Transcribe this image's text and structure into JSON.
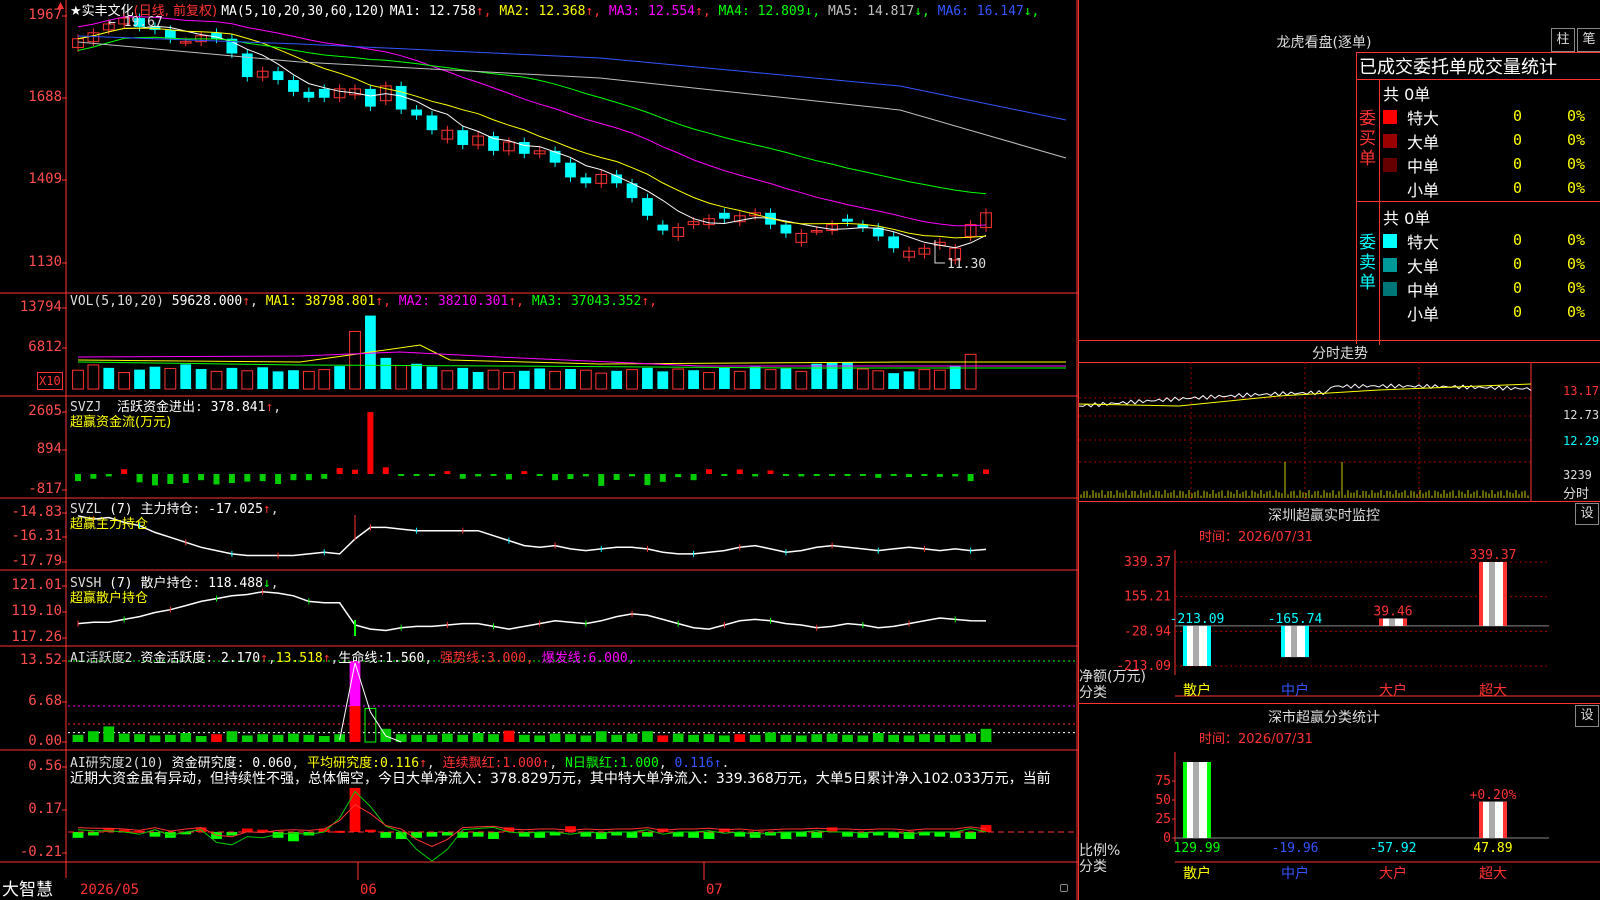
{
  "chart_data": [
    {
      "type": "candlestick",
      "title": "实丰文化",
      "name": "实丰文化",
      "period": "(日线, 前复权)",
      "ma_label": "MA(5,10,20,30,60,120)",
      "ma_values": [
        {
          "name": "MA1",
          "value": "12.758",
          "arrow": "↑",
          "color": "#ffffff"
        },
        {
          "name": "MA2",
          "value": "12.368",
          "arrow": "↑",
          "color": "#ffff00"
        },
        {
          "name": "MA3",
          "value": "12.554",
          "arrow": "↑",
          "color": "#ff00ff"
        },
        {
          "name": "MA4",
          "value": "12.809",
          "arrow": "↓",
          "color": "#00ff00"
        },
        {
          "name": "MA5",
          "value": "14.817",
          "arrow": "↓",
          "color": "#c0c0c0"
        },
        {
          "name": "MA6",
          "value": "16.147",
          "arrow": "↓",
          "color": "#3355ff"
        }
      ],
      "y_ticks": [
        "1967",
        "1688",
        "1409",
        "1130"
      ],
      "high_label": "19.67",
      "low_label": "11.30",
      "x_ticks": [
        "2026/05",
        "06",
        "07"
      ]
    },
    {
      "type": "bar",
      "title": "VOL(5,10,20)",
      "value": "59628.000",
      "ma_values": [
        {
          "name": "MA1",
          "value": "38798.801",
          "arrow": "↑",
          "color": "#ffff00"
        },
        {
          "name": "MA2",
          "value": "38210.301",
          "arrow": "↑",
          "color": "#ff00ff"
        },
        {
          "name": "MA3",
          "value": "37043.352",
          "arrow": "↑",
          "color": "#00ff00"
        }
      ],
      "y_ticks": [
        "13794",
        "6812"
      ],
      "unit": "X10",
      "values": [
        3.2,
        4.1,
        3.6,
        2.8,
        3.3,
        3.8,
        3.5,
        4.2,
        3.4,
        3.0,
        3.6,
        3.1,
        3.7,
        3.0,
        3.2,
        3.0,
        3.3,
        3.9,
        9.8,
        12.5,
        5.3,
        4.0,
        4.3,
        3.8,
        3.1,
        3.6,
        2.9,
        3.2,
        2.8,
        3.1,
        3.5,
        3.0,
        3.4,
        3.2,
        2.7,
        3.1,
        3.3,
        3.6,
        3.0,
        3.4,
        3.2,
        2.8,
        3.6,
        3.0,
        3.8,
        3.3,
        3.5,
        3.0,
        4.3,
        4.6,
        4.6,
        3.4,
        3.1,
        2.7,
        3.0,
        3.3,
        3.2,
        3.9,
        5.9
      ],
      "up": [
        1,
        1,
        0,
        1,
        0,
        0,
        1,
        0,
        0,
        1,
        0,
        1,
        0,
        0,
        0,
        1,
        1,
        0,
        1,
        0,
        0,
        1,
        0,
        0,
        1,
        0,
        0,
        1,
        1,
        0,
        0,
        1,
        0,
        1,
        1,
        0,
        1,
        0,
        0,
        1,
        0,
        1,
        0,
        1,
        0,
        1,
        0,
        1,
        0,
        0,
        0,
        1,
        1,
        0,
        0,
        1,
        1,
        0,
        1
      ]
    },
    {
      "type": "bar",
      "title": "SVZJ",
      "label": "活跃资金进出",
      "value": "378.841",
      "subtitle": "超赢资金流(万元)",
      "y_ticks": [
        "2605",
        "894",
        "-817"
      ],
      "values": [
        -300,
        -200,
        -100,
        200,
        -350,
        -480,
        -420,
        -380,
        -260,
        -440,
        -380,
        -320,
        -300,
        -420,
        -260,
        -260,
        -200,
        250,
        180,
        2600,
        280,
        -30,
        -40,
        -60,
        120,
        -200,
        -100,
        -60,
        -230,
        120,
        -40,
        -260,
        -210,
        -100,
        -500,
        -250,
        -100,
        -470,
        -330,
        -130,
        -260,
        200,
        -40,
        190,
        -100,
        150,
        -40,
        -100,
        -80,
        -40,
        -40,
        -60,
        -160,
        -40,
        -130,
        -40,
        -120,
        -100,
        -300,
        190
      ]
    },
    {
      "type": "line",
      "title": "SVZL",
      "label": "(7) 主力持仓",
      "value": "-17.025",
      "subtitle": "超赢主力持仓",
      "y_ticks": [
        "-14.83",
        "-16.31",
        "-17.79"
      ],
      "values": [
        -15.0,
        -15.2,
        -15.1,
        -15.4,
        -15.6,
        -16.0,
        -16.3,
        -16.6,
        -16.9,
        -17.1,
        -17.3,
        -17.4,
        -17.4,
        -17.4,
        -17.4,
        -17.3,
        -17.2,
        -17.3,
        -16.4,
        -15.7,
        -15.7,
        -15.8,
        -15.9,
        -15.9,
        -15.9,
        -15.9,
        -15.9,
        -16.2,
        -16.5,
        -16.8,
        -16.9,
        -16.8,
        -17.0,
        -17.1,
        -17.0,
        -16.9,
        -16.9,
        -17.0,
        -17.2,
        -17.3,
        -17.3,
        -17.2,
        -17.1,
        -16.9,
        -16.8,
        -17.0,
        -17.2,
        -17.1,
        -16.9,
        -16.8,
        -16.9,
        -17.0,
        -17.1,
        -17.0,
        -16.9,
        -17.0,
        -17.1,
        -17.0,
        -17.1,
        -17.03
      ]
    },
    {
      "type": "line",
      "title": "SVSH",
      "label": "(7) 散户持仓",
      "value": "118.488",
      "subtitle": "超赢散户持仓",
      "y_ticks": [
        "121.01",
        "119.10",
        "117.26"
      ],
      "values": [
        118.3,
        118.4,
        118.4,
        118.6,
        118.8,
        119.1,
        119.3,
        119.6,
        119.9,
        120.1,
        120.3,
        120.4,
        120.6,
        120.5,
        120.3,
        119.9,
        119.8,
        119.8,
        118.2,
        117.9,
        117.8,
        118.0,
        118.1,
        118.1,
        118.2,
        118.3,
        118.3,
        118.1,
        117.9,
        118.1,
        118.3,
        118.5,
        118.4,
        118.3,
        118.5,
        118.8,
        119.0,
        118.9,
        118.6,
        118.3,
        118.0,
        117.9,
        118.2,
        118.5,
        118.6,
        118.5,
        118.3,
        118.2,
        118.0,
        118.1,
        118.3,
        118.2,
        118.0,
        118.1,
        118.3,
        118.5,
        118.7,
        118.6,
        118.5,
        118.49
      ]
    },
    {
      "type": "bar",
      "title": "AI活跃度2",
      "label": "资金活跃度",
      "value": "2.170",
      "value2": "13.518",
      "life_label": "生命线",
      "life_value": "1.560",
      "strong_label": "强势线",
      "strong_value": "3.000",
      "burst_label": "爆发线",
      "burst_value": "6.000",
      "y_ticks": [
        "13.52",
        "6.68",
        "0.00"
      ],
      "values": [
        1.2,
        1.8,
        2.6,
        1.4,
        1.3,
        1.1,
        1.2,
        1.5,
        1.0,
        1.3,
        1.8,
        1.1,
        1.3,
        1.2,
        1.4,
        1.2,
        1.0,
        1.3,
        13.5,
        5.6,
        2.2,
        1.3,
        1.2,
        1.2,
        1.4,
        1.2,
        1.5,
        1.3,
        1.9,
        1.2,
        1.1,
        1.4,
        1.3,
        1.1,
        1.8,
        1.2,
        1.4,
        1.8,
        1.1,
        1.4,
        1.2,
        1.3,
        1.1,
        1.3,
        1.2,
        1.6,
        1.2,
        1.1,
        1.3,
        1.4,
        1.2,
        1.1,
        1.5,
        1.2,
        1.1,
        1.3,
        1.2,
        1.2,
        1.4,
        2.2
      ]
    },
    {
      "type": "bar",
      "title": "AI研究度2(10)",
      "label": "资金研究度",
      "value": "0.060",
      "avg_label": "平均研究度",
      "avg_value": "0.116",
      "lianxu_label": "连续飘红",
      "lianxu_value": "1.000",
      "nday_label": "N日飘红",
      "nday_value": "1.000",
      "last_value": "0.116",
      "y_ticks": [
        "0.56",
        "0.17",
        "-0.21"
      ],
      "values": [
        -0.05,
        -0.03,
        0.03,
        0.02,
        0.01,
        -0.04,
        -0.05,
        -0.02,
        0.04,
        -0.06,
        -0.03,
        0.03,
        0.02,
        -0.05,
        -0.08,
        -0.03,
        0.03,
        0.01,
        0.38,
        0.02,
        -0.05,
        -0.06,
        -0.05,
        -0.04,
        -0.03,
        -0.05,
        -0.04,
        -0.06,
        0.04,
        -0.04,
        -0.05,
        -0.03,
        0.05,
        -0.04,
        -0.06,
        -0.03,
        -0.05,
        -0.04,
        0.03,
        -0.04,
        -0.05,
        -0.06,
        0.03,
        -0.04,
        -0.05,
        -0.03,
        -0.06,
        -0.04,
        -0.05,
        0.04,
        -0.04,
        -0.05,
        -0.03,
        -0.05,
        -0.06,
        -0.03,
        -0.04,
        -0.05,
        -0.06,
        0.06
      ],
      "line": [
        0.02,
        0.01,
        0.01,
        0.0,
        -0.02,
        0.02,
        -0.03,
        0.0,
        0.02,
        -0.09,
        -0.11,
        -0.04,
        -0.05,
        -0.02,
        -0.01,
        -0.02,
        0.0,
        0.12,
        0.35,
        0.22,
        0.05,
        0.0,
        -0.15,
        -0.25,
        -0.15,
        0.02,
        0.03,
        0.04,
        0.0,
        -0.01,
        0.0,
        0.0,
        -0.02,
        0.0,
        -0.01,
        0.0,
        0.0,
        0.02,
        -0.02,
        0.0,
        0.0,
        0.01,
        -0.01,
        0.0,
        -0.02,
        -0.01,
        0.0,
        0.0,
        0.01,
        0.0,
        0.0,
        -0.01,
        0.0,
        0.0,
        -0.02,
        0.0,
        0.0,
        0.0,
        0.03,
        0.0
      ]
    }
  ],
  "ai_text": "近期大资金虽有异动，但持续性不强，总体偏空，今日大单净流入：378.829万元，其中特大单净流入：339.368万元，大单5日累计净入102.033万元，当前",
  "brand": "大智慧",
  "right": {
    "longhu_title": "龙虎看盘(逐单)",
    "tab_zhu": "柱",
    "tab_bi": "笔",
    "order_header": "已成交委托单成交量统计",
    "buy_label": "委买单",
    "sell_label": "委卖单",
    "buy_total": "共 0单",
    "sell_total": "共 0单",
    "buy_rows": [
      {
        "label": "特大",
        "count": "0",
        "pct": "0%",
        "color": "#ff0000"
      },
      {
        "label": "大单",
        "count": "0",
        "pct": "0%",
        "color": "#990000"
      },
      {
        "label": "中单",
        "count": "0",
        "pct": "0%",
        "color": "#660000"
      },
      {
        "label": "小单",
        "count": "0",
        "pct": "0%",
        "color": ""
      }
    ],
    "sell_rows": [
      {
        "label": "特大",
        "count": "0",
        "pct": "0%",
        "color": "#00ffff"
      },
      {
        "label": "大单",
        "count": "0",
        "pct": "0%",
        "color": "#009999"
      },
      {
        "label": "中单",
        "count": "0",
        "pct": "0%",
        "color": "#007777"
      },
      {
        "label": "小单",
        "count": "0",
        "pct": "0%",
        "color": ""
      }
    ],
    "intraday_title": "分时走势",
    "intraday_ticks": [
      "13.17",
      "12.73",
      "12.29",
      "3239",
      "分时"
    ],
    "sz_title": "深圳超赢实时监控",
    "sz_settings": "设",
    "sz_time_label": "时间：",
    "sz_time": "2026/07/31",
    "sz_y_ticks": [
      "339.37",
      "155.21",
      "-28.94",
      "-213.09"
    ],
    "sz_y_axis_label": "净额(万元)",
    "sz_x_axis_label": "分类",
    "sz_categories": [
      "散户",
      "中户",
      "大户",
      "超大"
    ],
    "sz_values": [
      -213.09,
      -165.74,
      39.46,
      339.37
    ],
    "sz_value_labels": [
      "-213.09",
      "-165.74",
      "39.46",
      "339.37"
    ],
    "sh_title": "深市超赢分类统计",
    "sh_settings": "设",
    "sh_time_label": "时间：",
    "sh_time": "2026/07/31",
    "sh_y_ticks": [
      "75",
      "50",
      "25",
      "0"
    ],
    "sh_y_axis_label": "比例%",
    "sh_x_axis_label": "分类",
    "sh_categories": [
      "散户",
      "中户",
      "大户",
      "超大"
    ],
    "sh_values": [
      129.99,
      -19.96,
      -57.92,
      47.89
    ],
    "sh_value_labels": [
      "129.99",
      "-19.96",
      "-57.92",
      "47.89"
    ],
    "sh_pct_label": "+0.20%"
  }
}
